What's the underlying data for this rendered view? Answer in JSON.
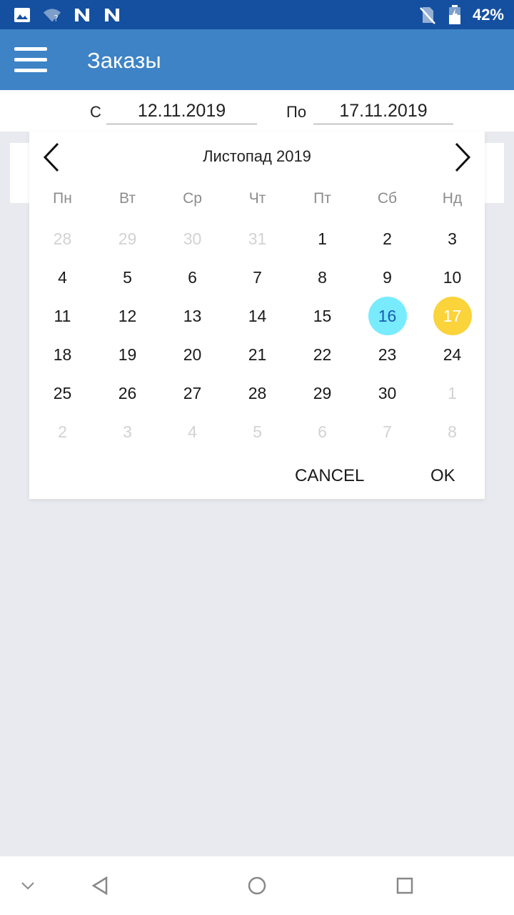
{
  "status_bar": {
    "battery_text": "42%",
    "icons": [
      "image-icon",
      "wifi-question-icon",
      "n-app-icon",
      "n-app-icon",
      "no-sim-icon",
      "battery-icon"
    ]
  },
  "app_bar": {
    "title": "Заказы",
    "menu_icon": "hamburger-menu-icon"
  },
  "filter": {
    "from_label": "С",
    "from_value": "12.11.2019",
    "to_label": "По",
    "to_value": "17.11.2019"
  },
  "calendar": {
    "month_title": "Листопад 2019",
    "prev_icon": "chevron-left-icon",
    "next_icon": "chevron-right-icon",
    "weekdays": [
      "Пн",
      "Вт",
      "Ср",
      "Чт",
      "Пт",
      "Сб",
      "Нд"
    ],
    "weeks": [
      [
        "28",
        "29",
        "30",
        "31",
        "1",
        "2",
        "3"
      ],
      [
        "4",
        "5",
        "6",
        "7",
        "8",
        "9",
        "10"
      ],
      [
        "11",
        "12",
        "13",
        "14",
        "15",
        "16",
        "17"
      ],
      [
        "18",
        "19",
        "20",
        "21",
        "22",
        "23",
        "24"
      ],
      [
        "25",
        "26",
        "27",
        "28",
        "29",
        "30",
        "1"
      ],
      [
        "2",
        "3",
        "4",
        "5",
        "6",
        "7",
        "8"
      ]
    ],
    "today_day": "16",
    "today_color": "#78ebff",
    "today_text_color": "#1a5bb0",
    "selected_day": "17",
    "selected_color": "#fbd33a",
    "selected_text_color": "#ffffff",
    "cancel_label": "CANCEL",
    "ok_label": "OK"
  },
  "colors": {
    "status_bar": "#1550a0",
    "app_bar": "#3d83c6",
    "background": "#e9eaef"
  },
  "nav_bar": {
    "icons": [
      "chevron-down-icon",
      "back-triangle-icon",
      "home-circle-icon",
      "recents-square-icon"
    ]
  }
}
